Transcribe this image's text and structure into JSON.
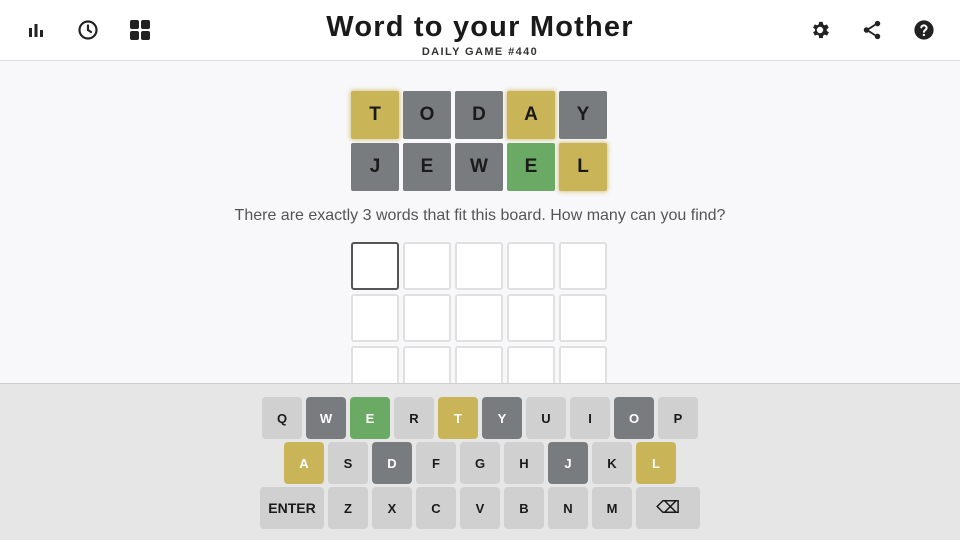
{
  "header": {
    "title": "Word to your Mother",
    "subtitle": "DAILY GAME #440",
    "left_icons": [
      "stats-icon",
      "history-icon",
      "grid-icon"
    ],
    "right_icons": [
      "gear-icon",
      "share-icon",
      "help-icon"
    ]
  },
  "board": {
    "rows": [
      [
        {
          "letter": "T",
          "state": "yellow"
        },
        {
          "letter": "O",
          "state": "gray"
        },
        {
          "letter": "D",
          "state": "gray"
        },
        {
          "letter": "A",
          "state": "yellow"
        },
        {
          "letter": "Y",
          "state": "gray"
        }
      ],
      [
        {
          "letter": "J",
          "state": "gray"
        },
        {
          "letter": "E",
          "state": "gray"
        },
        {
          "letter": "W",
          "state": "gray"
        },
        {
          "letter": "E",
          "state": "green"
        },
        {
          "letter": "L",
          "state": "yellow"
        }
      ]
    ]
  },
  "prompt": "There are exactly 3 words that fit this board. How many can you find?",
  "keyboard": {
    "rows": [
      [
        {
          "label": "Q",
          "state": "unused"
        },
        {
          "label": "W",
          "state": "absent"
        },
        {
          "label": "E",
          "state": "correct"
        },
        {
          "label": "R",
          "state": "unused"
        },
        {
          "label": "T",
          "state": "present"
        },
        {
          "label": "Y",
          "state": "absent"
        },
        {
          "label": "U",
          "state": "unused"
        },
        {
          "label": "I",
          "state": "unused"
        },
        {
          "label": "O",
          "state": "absent"
        },
        {
          "label": "P",
          "state": "unused"
        }
      ],
      [
        {
          "label": "A",
          "state": "present"
        },
        {
          "label": "S",
          "state": "unused"
        },
        {
          "label": "D",
          "state": "absent"
        },
        {
          "label": "F",
          "state": "unused"
        },
        {
          "label": "G",
          "state": "unused"
        },
        {
          "label": "H",
          "state": "unused"
        },
        {
          "label": "J",
          "state": "absent"
        },
        {
          "label": "K",
          "state": "unused"
        },
        {
          "label": "L",
          "state": "present"
        }
      ],
      [
        {
          "label": "ENTER",
          "state": "unused",
          "kind": "wide"
        },
        {
          "label": "Z",
          "state": "unused"
        },
        {
          "label": "X",
          "state": "unused"
        },
        {
          "label": "C",
          "state": "unused"
        },
        {
          "label": "V",
          "state": "unused"
        },
        {
          "label": "B",
          "state": "unused"
        },
        {
          "label": "N",
          "state": "unused"
        },
        {
          "label": "M",
          "state": "unused"
        },
        {
          "label": "⌫",
          "state": "unused",
          "kind": "back"
        }
      ]
    ]
  },
  "colors": {
    "gray": "#787c7e",
    "yellow": "#c9b458",
    "green": "#6aaa64",
    "key_default": "#d0d0d0"
  }
}
